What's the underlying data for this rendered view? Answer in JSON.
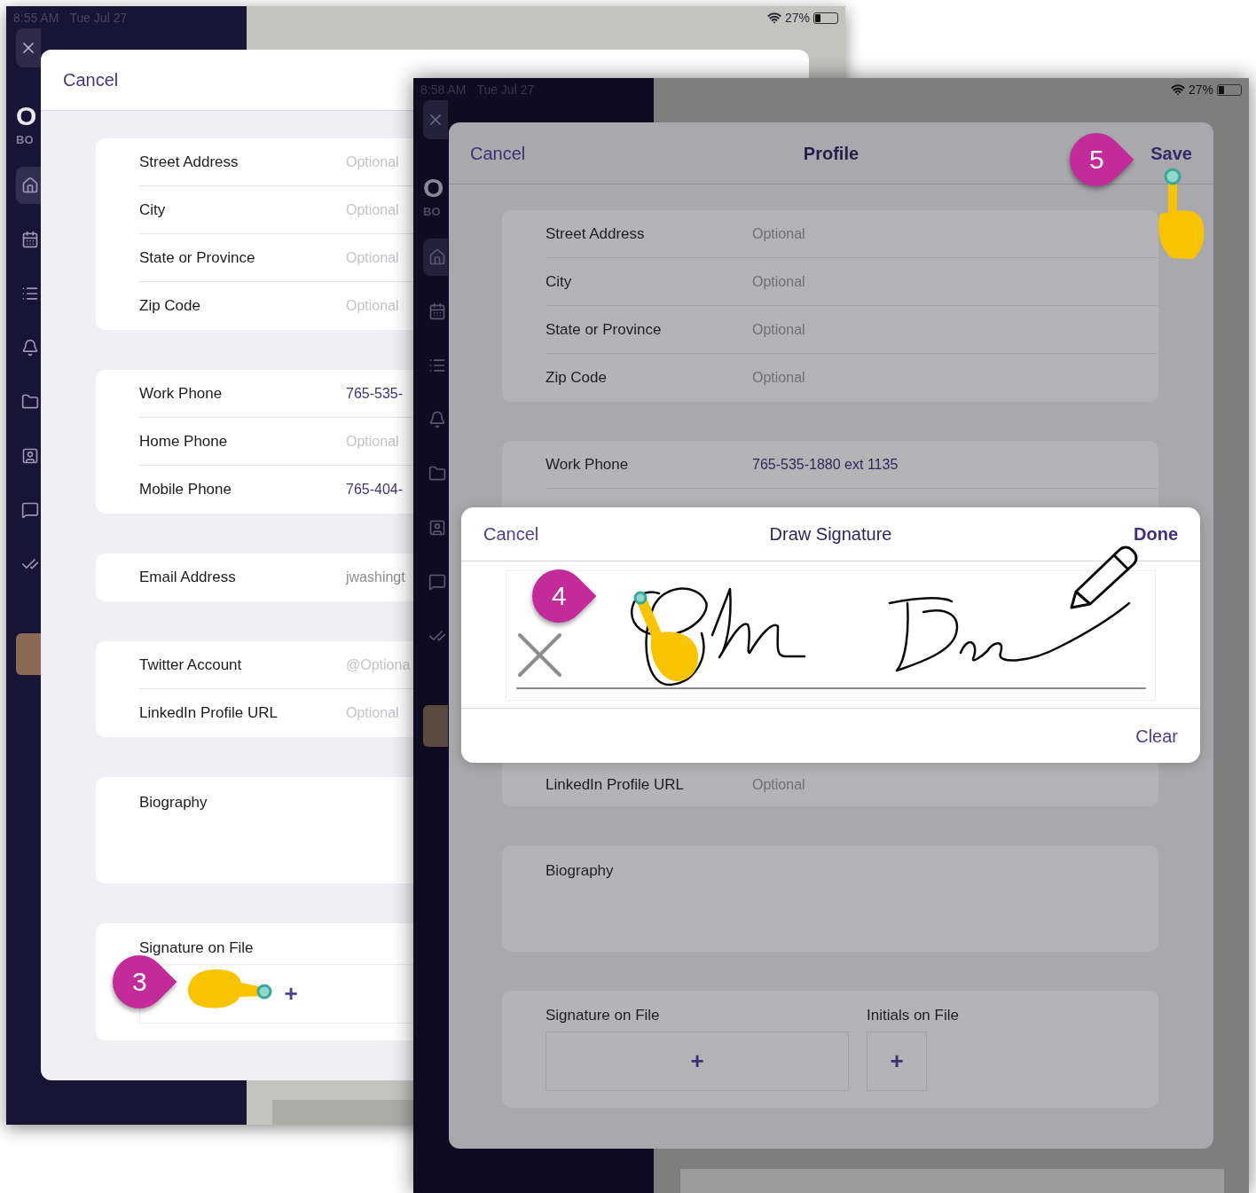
{
  "left_screen": {
    "status_bar": {
      "time": "8:55 AM",
      "date": "Tue Jul 27",
      "battery": "27%"
    },
    "sidebar": {
      "logo": "O",
      "org": "BO",
      "items": [
        {
          "kind": "home",
          "selected": true
        },
        {
          "kind": "calendar",
          "selected": false
        },
        {
          "kind": "list",
          "selected": false
        },
        {
          "kind": "bell",
          "selected": false
        },
        {
          "kind": "folder",
          "selected": false
        },
        {
          "kind": "contacts",
          "selected": false
        },
        {
          "kind": "chat",
          "selected": false
        },
        {
          "kind": "tasks",
          "selected": false
        }
      ]
    },
    "sheet": {
      "cancel": "Cancel",
      "groups": [
        {
          "rows": [
            {
              "label": "Street Address",
              "placeholder": "Optional"
            },
            {
              "label": "City",
              "placeholder": "Optional"
            },
            {
              "label": "State or Province",
              "placeholder": "Optional"
            },
            {
              "label": "Zip Code",
              "placeholder": "Optional"
            }
          ]
        },
        {
          "rows": [
            {
              "label": "Work Phone",
              "value": "765-535-",
              "kind": "link"
            },
            {
              "label": "Home Phone",
              "placeholder": "Optional"
            },
            {
              "label": "Mobile Phone",
              "value": "765-404-",
              "kind": "link"
            }
          ]
        },
        {
          "rows": [
            {
              "label": "Email Address",
              "value": "jwashingt",
              "kind": "muted"
            }
          ]
        },
        {
          "rows": [
            {
              "label": "Twitter Account",
              "placeholder": "@Optiona"
            },
            {
              "label": "LinkedIn Profile URL",
              "placeholder": "Optional"
            }
          ]
        }
      ],
      "biography": "Biography",
      "attachments": [
        {
          "label": "Signature on File",
          "add": "+"
        }
      ]
    }
  },
  "right_screen": {
    "status_bar": {
      "time": "8:58 AM",
      "date": "Tue Jul 27",
      "battery": "27%"
    },
    "sidebar": {
      "logo": "O",
      "org": "BO",
      "items": [
        {
          "kind": "home",
          "selected": true
        },
        {
          "kind": "calendar",
          "selected": false
        },
        {
          "kind": "list",
          "selected": false
        },
        {
          "kind": "bell",
          "selected": false
        },
        {
          "kind": "folder",
          "selected": false
        },
        {
          "kind": "contacts",
          "selected": false
        },
        {
          "kind": "chat",
          "selected": false
        },
        {
          "kind": "tasks",
          "selected": false
        }
      ]
    },
    "sheet": {
      "cancel": "Cancel",
      "title": "Profile",
      "save": "Save",
      "address_rows": [
        {
          "label": "Street Address",
          "placeholder": "Optional"
        },
        {
          "label": "City",
          "placeholder": "Optional"
        },
        {
          "label": "State or Province",
          "placeholder": "Optional"
        },
        {
          "label": "Zip Code",
          "placeholder": "Optional"
        }
      ],
      "phone_row": {
        "label": "Work Phone",
        "value": "765-535-1880 ext 1135",
        "kind": "link"
      },
      "signature_dialog": {
        "cancel": "Cancel",
        "title": "Draw Signature",
        "done": "Done",
        "clear": "Clear"
      },
      "linkedin_row": {
        "label": "LinkedIn Profile URL",
        "placeholder": "Optional"
      },
      "biography": "Biography",
      "attachments": [
        {
          "label": "Signature on File",
          "add": "+",
          "kind": "wide"
        },
        {
          "label": "Initials on File",
          "add": "+",
          "kind": "narrow"
        }
      ]
    }
  },
  "steps": [
    {
      "number": "3"
    },
    {
      "number": "4"
    },
    {
      "number": "5"
    }
  ]
}
